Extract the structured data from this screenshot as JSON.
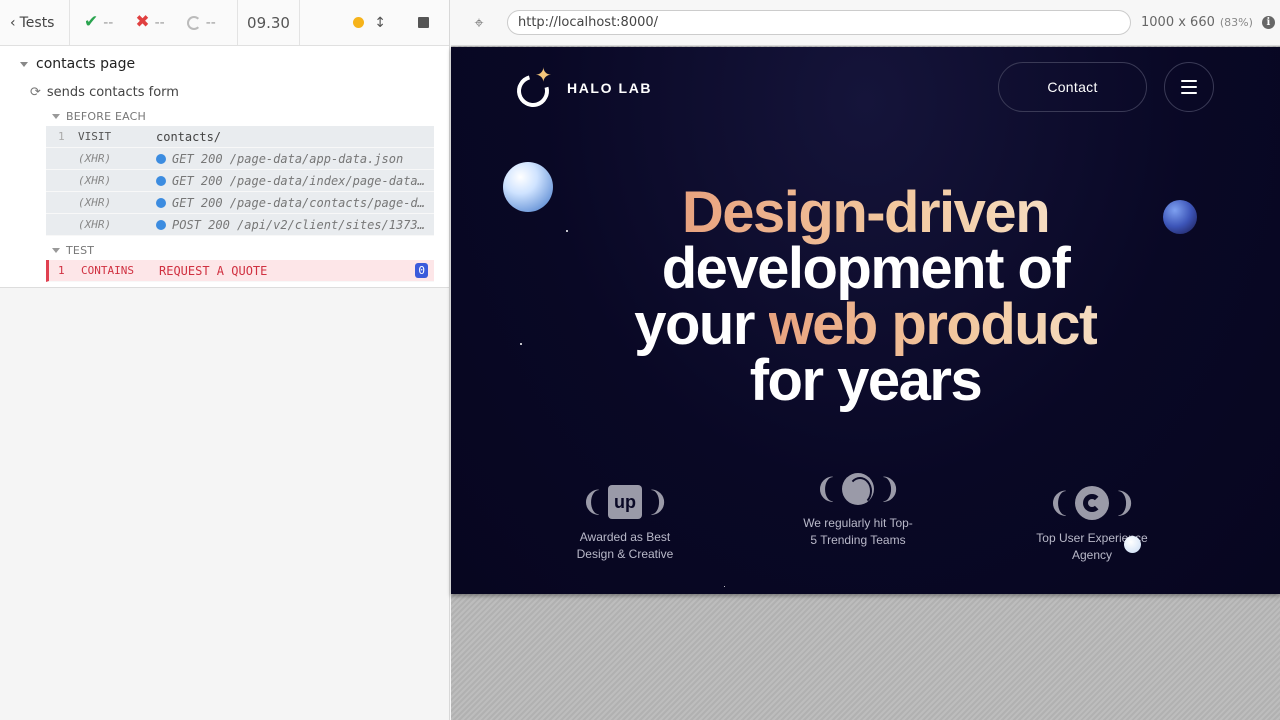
{
  "reporter": {
    "back_label": "Tests",
    "passed": "--",
    "failed": "--",
    "pending": "--",
    "duration": "09.30",
    "suite_title": "contacts page",
    "test_title": "sends contacts form",
    "before_each_label": "BEFORE EACH",
    "test_label": "TEST",
    "before_each_commands": [
      {
        "num": "1",
        "name": "VISIT",
        "message": "contacts/"
      },
      {
        "num": "",
        "name": "(XHR)",
        "message": "GET 200 /page-data/app-data.json"
      },
      {
        "num": "",
        "name": "(XHR)",
        "message": "GET 200 /page-data/index/page-data.json"
      },
      {
        "num": "",
        "name": "(XHR)",
        "message": "GET 200 /page-data/contacts/page-data.json"
      },
      {
        "num": "",
        "name": "(XHR)",
        "message": "POST 200 /api/v2/client/sites/1373..."
      }
    ],
    "test_commands": [
      {
        "num": "1",
        "name": "CONTAINS",
        "message": "REQUEST A QUOTE",
        "badge": "0"
      }
    ]
  },
  "aut": {
    "url": "http://localhost:8000/",
    "viewport": "1000 x 660",
    "scale": "(83%)"
  },
  "site": {
    "logo_text": "HALO LAB",
    "contact_label": "Contact",
    "hero": {
      "line1_grad": "Design-driven",
      "line2": "development of",
      "line3_a": "your ",
      "line3_grad": "web product",
      "line4": "for years"
    },
    "awards": [
      {
        "line1": "Awarded as Best",
        "line2": "Design & Creative",
        "logo": "up"
      },
      {
        "line1": "We regularly hit Top-",
        "line2": "5 Trending Teams",
        "logo": "dribbble"
      },
      {
        "line1": "Top User Experience",
        "line2": "Agency",
        "logo": "c"
      }
    ]
  }
}
